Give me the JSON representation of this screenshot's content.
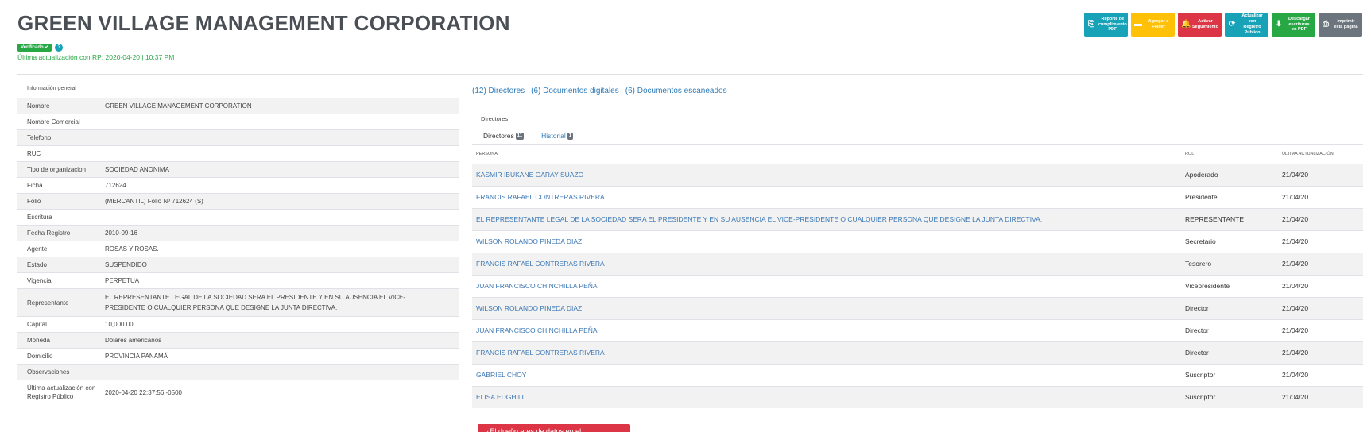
{
  "company": {
    "name": "GREEN VILLAGE MANAGEMENT CORPORATION",
    "verified_label": "Verificado ✔",
    "info_icon": "?",
    "last_update": "Última actualización con RP: 2020-04-20 | 10:37 PM"
  },
  "actions": [
    {
      "icon": "pdf-icon",
      "glyph": "⎘",
      "label": "Reporte de cumplimiento PDF",
      "color": "#17a2b8"
    },
    {
      "icon": "folder-icon",
      "glyph": "▬",
      "label": "Agregar a Folder",
      "color": "#ffc107"
    },
    {
      "icon": "bell-icon",
      "glyph": "🔔",
      "label": "Activar Seguimiento",
      "color": "#dc3545"
    },
    {
      "icon": "refresh-icon",
      "glyph": "⟳",
      "label": "Actualizar con Registro Público",
      "color": "#17a2b8"
    },
    {
      "icon": "download-icon",
      "glyph": "⬇",
      "label": "Descargar escrituras en PDF",
      "color": "#28a745"
    },
    {
      "icon": "print-icon",
      "glyph": "⎙",
      "label": "Imprimir esta página",
      "color": "#6c757d"
    }
  ],
  "general_info": {
    "caption": "Información general",
    "rows": [
      {
        "key": "Nombre",
        "value": "GREEN VILLAGE MANAGEMENT CORPORATION"
      },
      {
        "key": "Nombre Comercial",
        "value": ""
      },
      {
        "key": "Telefono",
        "value": ""
      },
      {
        "key": "RUC",
        "value": ""
      },
      {
        "key": "Tipo de organizacion",
        "value": "SOCIEDAD ANONIMA"
      },
      {
        "key": "Ficha",
        "value": "712624"
      },
      {
        "key": "Folio",
        "value": "(MERCANTIL) Folio Nº 712624 (S)"
      },
      {
        "key": "Escritura",
        "value": ""
      },
      {
        "key": "Fecha Registro",
        "value": "2010-09-16"
      },
      {
        "key": "Agente",
        "value": "ROSAS Y ROSAS."
      },
      {
        "key": "Estado",
        "value": "SUSPENDIDO"
      },
      {
        "key": "Vigencia",
        "value": "PERPETUA"
      },
      {
        "key": "Representante",
        "value": "EL REPRESENTANTE LEGAL DE LA SOCIEDAD SERA EL PRESIDENTE Y EN SU AUSENCIA EL VICE-PRESIDENTE O CUALQUIER PERSONA QUE DESIGNE LA JUNTA DIRECTIVA."
      },
      {
        "key": "Capital",
        "value": "10,000.00"
      },
      {
        "key": "Moneda",
        "value": "Dólares americanos"
      },
      {
        "key": "Domicilio",
        "value": "PROVINCIA PANAMÁ"
      },
      {
        "key": "Observaciones",
        "value": ""
      },
      {
        "key": "Última actualización con Registro Público",
        "value": "2020-04-20 22:37:56 -0500"
      }
    ]
  },
  "tabs": [
    "(12) Directores",
    "(6) Documentos digitales",
    "(6) Documentos escaneados"
  ],
  "directors": {
    "section_title": "Directores",
    "subtabs": [
      {
        "label": "Directores",
        "count": "11"
      },
      {
        "label": "Historial",
        "count": "1"
      }
    ],
    "headers": {
      "person": "PERSONA",
      "rol": "ROL",
      "date": "ÚLTIMA ACTUALIZACIÓN"
    },
    "rows": [
      {
        "person": "KASMIR IBUKANE GARAY SUAZO",
        "rol": "Apoderado",
        "date": "21/04/20"
      },
      {
        "person": "FRANCIS RAFAEL CONTRERAS RIVERA",
        "rol": "Presidente",
        "date": "21/04/20"
      },
      {
        "person": "EL REPRESENTANTE LEGAL DE LA SOCIEDAD SERA EL PRESIDENTE Y EN SU AUSENCIA EL VICE-PRESIDENTE O CUALQUIER PERSONA QUE DESIGNE LA JUNTA DIRECTIVA.",
        "rol": "REPRESENTANTE",
        "date": "21/04/20"
      },
      {
        "person": "WILSON ROLANDO PINEDA DIAZ",
        "rol": "Secretario",
        "date": "21/04/20"
      },
      {
        "person": "FRANCIS RAFAEL CONTRERAS RIVERA",
        "rol": "Tesorero",
        "date": "21/04/20"
      },
      {
        "person": "JUAN FRANCISCO CHINCHILLA PEÑA",
        "rol": "Vicepresidente",
        "date": "21/04/20"
      },
      {
        "person": "WILSON ROLANDO PINEDA DIAZ",
        "rol": "Director",
        "date": "21/04/20"
      },
      {
        "person": "JUAN FRANCISCO CHINCHILLA PEÑA",
        "rol": "Director",
        "date": "21/04/20"
      },
      {
        "person": "FRANCIS RAFAEL CONTRERAS RIVERA",
        "rol": "Director",
        "date": "21/04/20"
      },
      {
        "person": "GABRIEL CHOY",
        "rol": "Suscriptor",
        "date": "21/04/20"
      },
      {
        "person": "ELISA EDGHILL",
        "rol": "Suscriptor",
        "date": "21/04/20"
      }
    ]
  },
  "bottom_button": "¿El dueño eres de datos en el..."
}
